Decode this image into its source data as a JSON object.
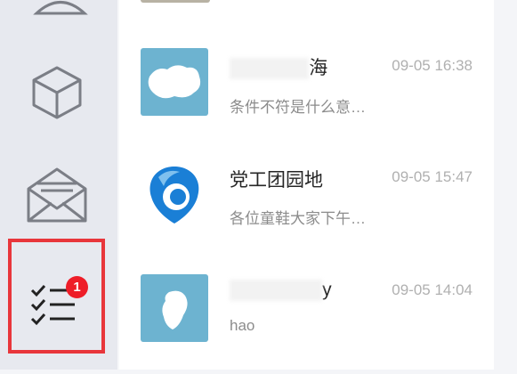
{
  "sidebar": {
    "items": [
      {
        "name": "contacts",
        "icon": "person-icon"
      },
      {
        "name": "apps",
        "icon": "cube-icon"
      },
      {
        "name": "mail",
        "icon": "envelope-icon"
      },
      {
        "name": "tasks",
        "icon": "checklist-icon",
        "badge": "1",
        "active": true
      }
    ]
  },
  "conversations": [
    {
      "name": "海",
      "time": "09-05 16:38",
      "preview": "条件不符是什么意…",
      "avatar_color": "#6db3d0"
    },
    {
      "name": "党工团园地",
      "time": "09-05 15:47",
      "preview": "各位童鞋大家下午…",
      "avatar_color": "#1a7fd6"
    },
    {
      "name": "y",
      "time": "09-05 14:04",
      "preview": "hao",
      "avatar_color": "#6db3d0"
    }
  ],
  "colors": {
    "accent_red": "#e8363b",
    "badge": "#ee1d28"
  }
}
